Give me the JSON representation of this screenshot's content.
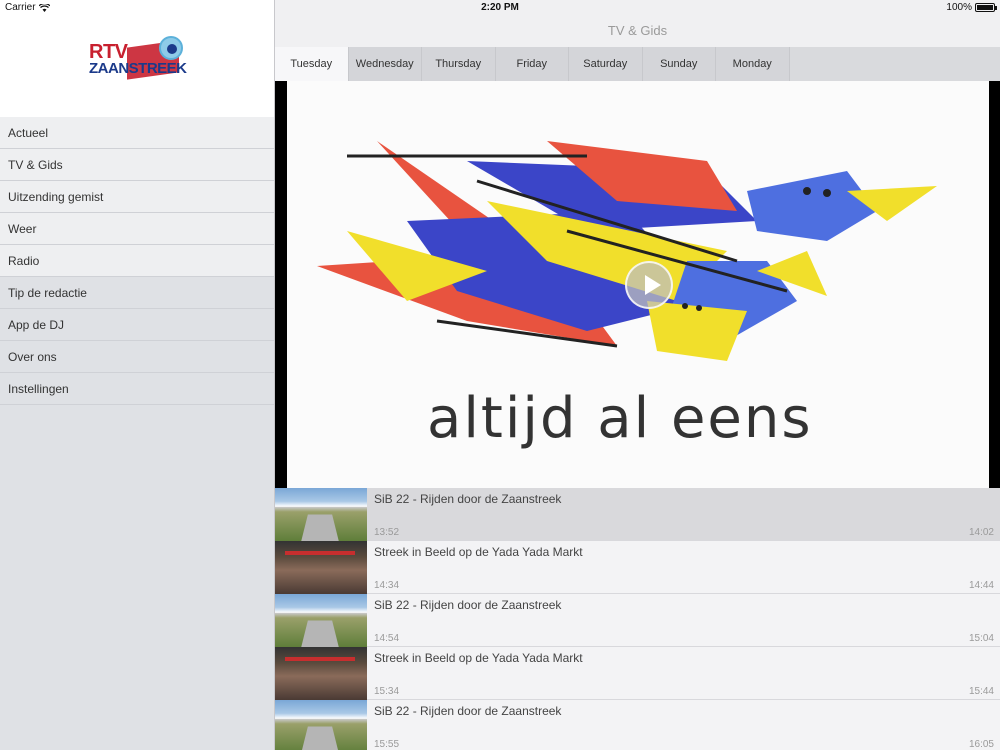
{
  "status_bar": {
    "carrier": "Carrier",
    "time": "2:20 PM",
    "battery_percent": "100%"
  },
  "sidebar": {
    "logo_line1": "RTV",
    "logo_line2": "ZAANSTREEK",
    "items": [
      {
        "label": "Actueel"
      },
      {
        "label": "TV & Gids"
      },
      {
        "label": "Uitzending gemist"
      },
      {
        "label": "Weer"
      },
      {
        "label": "Radio"
      },
      {
        "label": "Tip de redactie"
      },
      {
        "label": "App de DJ"
      },
      {
        "label": "Over ons"
      },
      {
        "label": "Instellingen"
      }
    ]
  },
  "main": {
    "title": "TV & Gids",
    "tabs": [
      {
        "label": "Tuesday",
        "active": true
      },
      {
        "label": "Wednesday"
      },
      {
        "label": "Thursday"
      },
      {
        "label": "Friday"
      },
      {
        "label": "Saturday"
      },
      {
        "label": "Sunday"
      },
      {
        "label": "Monday"
      }
    ],
    "video": {
      "caption": "altijd al eens"
    },
    "programs": [
      {
        "title": "SiB 22 - Rijden door de Zaanstreek",
        "start": "13:52",
        "end": "14:02",
        "thumb": "road",
        "selected": true
      },
      {
        "title": "Streek in Beeld op de Yada Yada Markt",
        "start": "14:34",
        "end": "14:44",
        "thumb": "market"
      },
      {
        "title": "SiB 22 - Rijden door de Zaanstreek",
        "start": "14:54",
        "end": "15:04",
        "thumb": "road"
      },
      {
        "title": "Streek in Beeld op de Yada Yada Markt",
        "start": "15:34",
        "end": "15:44",
        "thumb": "market"
      },
      {
        "title": "SiB 22 - Rijden door de Zaanstreek",
        "start": "15:55",
        "end": "16:05",
        "thumb": "road"
      }
    ]
  },
  "colors": {
    "sidebar_bg": "#dfe1e5",
    "tab_active": "#f7f7f9",
    "logo_red": "#c8202f",
    "logo_blue": "#1b3a8a"
  }
}
